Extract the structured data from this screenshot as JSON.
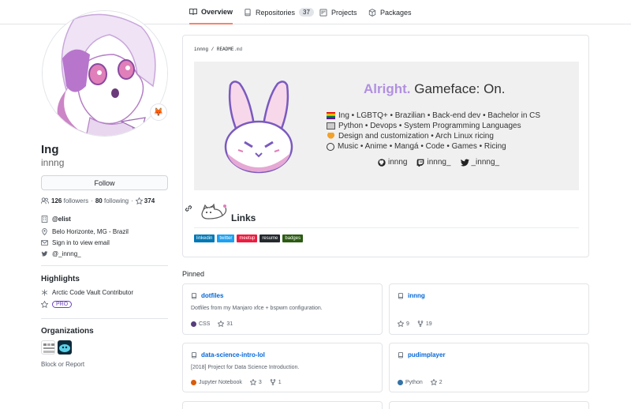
{
  "tabs": [
    {
      "label": "Overview",
      "active": true
    },
    {
      "label": "Repositories",
      "count": "37"
    },
    {
      "label": "Projects"
    },
    {
      "label": "Packages"
    }
  ],
  "profile": {
    "name": "Ing",
    "login": "innng",
    "status_emoji": "🦊",
    "follow_label": "Follow",
    "followers_count": "126",
    "followers_label": "followers",
    "following_count": "80",
    "following_label": "following",
    "stars_count": "374",
    "company": "@elist",
    "location": "Belo Horizonte, MG - Brazil",
    "email": "Sign in to view email",
    "twitter": "@_innng_"
  },
  "highlights": {
    "heading": "Highlights",
    "arctic": "Arctic Code Vault Contributor",
    "pro": "PRO"
  },
  "organizations": {
    "heading": "Organizations",
    "block": "Block or Report"
  },
  "readme": {
    "owner": "innng",
    "sep": "/",
    "file": "README",
    "ext": ".md",
    "banner_title_bold": "Alright.",
    "banner_title_rest": " Gameface: On.",
    "lines": [
      "Ing • LGBTQ+ • Brazilian • Back-end dev • Bachelor in CS",
      "Python • Devops • System Programming Languages",
      "Design and customization • Arch Linux ricing",
      "Music • Anime • Mangá • Code • Games • Ricing"
    ],
    "social_github": "innng",
    "social_twitch": "innng_",
    "social_twitter": "_innng_",
    "links_title": "Links",
    "badges": [
      {
        "label": "linkedin",
        "color": "#0077b5"
      },
      {
        "label": "twitter",
        "color": "#1da1f2"
      },
      {
        "label": "meetup",
        "color": "#ed1c40"
      },
      {
        "label": "resume",
        "color": "#24292e"
      },
      {
        "label": "badges",
        "color": "#2b5b12"
      }
    ]
  },
  "pinned": {
    "heading": "Pinned",
    "cards": [
      {
        "name": "dotfiles",
        "desc": "Dotfiles from my Manjaro xfce + bspwm configuration.",
        "lang": "CSS",
        "lang_color": "#563d7c",
        "stars": "31",
        "forks": ""
      },
      {
        "name": "innng",
        "desc": "",
        "lang": "",
        "lang_color": "",
        "stars": "9",
        "forks": "19"
      },
      {
        "name": "data-science-intro-lol",
        "desc": "[2018] Project for Data Science Introduction.",
        "lang": "Jupyter Notebook",
        "lang_color": "#DA5B0B",
        "stars": "3",
        "forks": "1"
      },
      {
        "name": "pudimplayer",
        "desc": "",
        "lang": "Python",
        "lang_color": "#3572A5",
        "stars": "2",
        "forks": ""
      }
    ]
  }
}
